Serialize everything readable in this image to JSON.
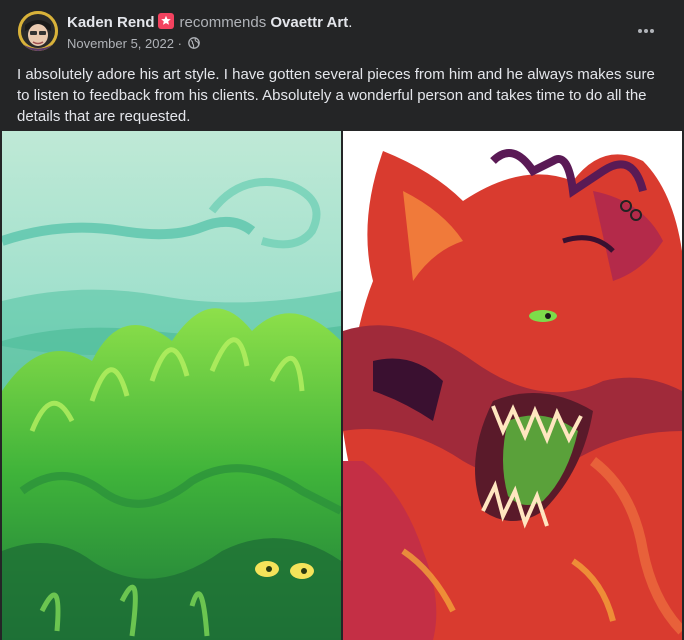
{
  "post": {
    "author": "Kaden Rend",
    "action": "recommends",
    "page_name": "Ovaettr Art",
    "punctuation": ".",
    "date": "November 5, 2022",
    "separator": "·",
    "body": "I absolutely adore his art style. I have gotten several pieces from him and he always makes sure to listen to feedback from his clients. Absolutely a wonderful person and takes time to do all the details that are requested.",
    "more_label": "•••"
  },
  "icons": {
    "badge": "recommendation-star-icon",
    "privacy": "globe-icon",
    "more": "more-options-icon"
  },
  "colors": {
    "background": "#242526",
    "text_primary": "#e4e6eb",
    "text_secondary": "#b0b3b8",
    "badge": "#f3425f"
  },
  "images": [
    {
      "name": "green-creature-artwork"
    },
    {
      "name": "red-wolf-artwork"
    }
  ]
}
